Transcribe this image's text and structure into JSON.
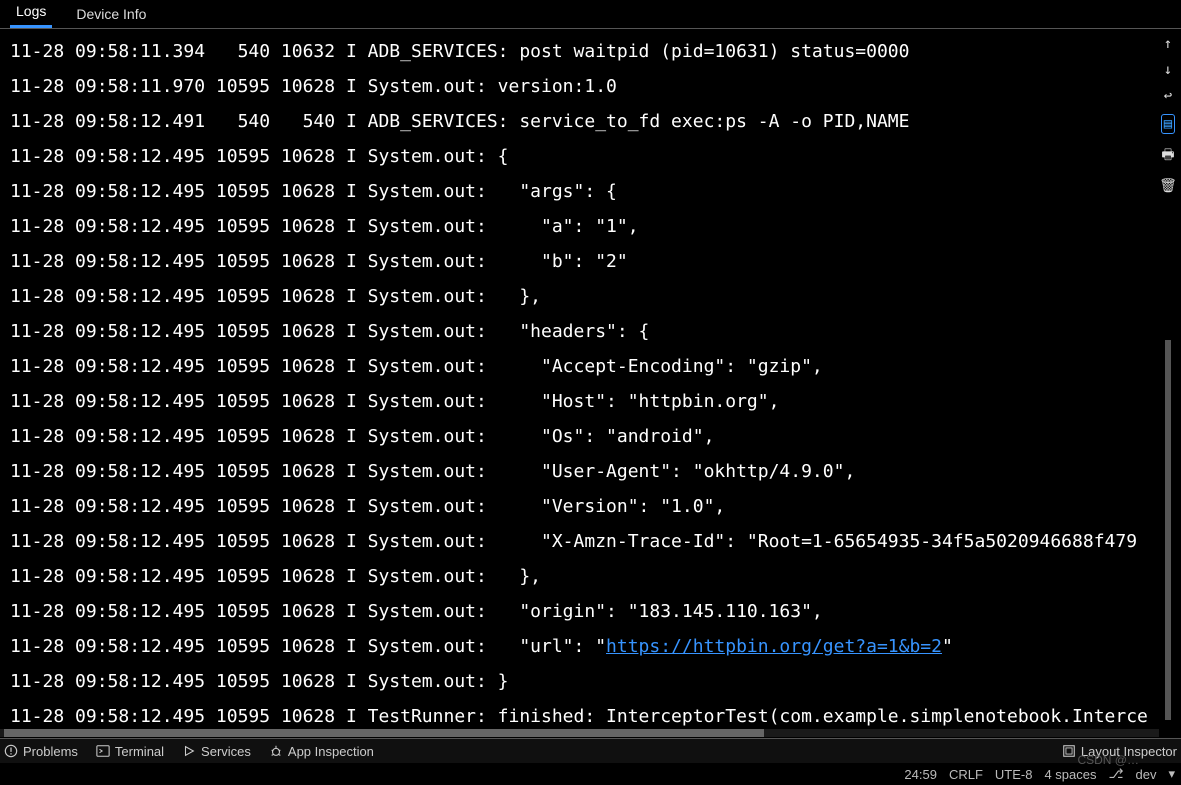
{
  "tabs": {
    "logs": "Logs",
    "device_info": "Device Info",
    "active": "logs"
  },
  "right_icons": [
    "arrow-up",
    "arrow-down",
    "wrap",
    "layout",
    "print",
    "trash"
  ],
  "right_selected_index": 3,
  "log_lines": [
    {
      "date": "11-28",
      "time": "09:58:11.394",
      "pid": "  540",
      "tid": "10632",
      "lvl": "I",
      "tag": "ADB_SERVICES",
      "msg": "post waitpid (pid=10631) status=0000"
    },
    {
      "date": "11-28",
      "time": "09:58:11.970",
      "pid": "10595",
      "tid": "10628",
      "lvl": "I",
      "tag": "System.out",
      "msg": "version:1.0"
    },
    {
      "date": "11-28",
      "time": "09:58:12.491",
      "pid": "  540",
      "tid": "  540",
      "lvl": "I",
      "tag": "ADB_SERVICES",
      "msg": "service_to_fd exec:ps -A -o PID,NAME"
    },
    {
      "date": "11-28",
      "time": "09:58:12.495",
      "pid": "10595",
      "tid": "10628",
      "lvl": "I",
      "tag": "System.out",
      "msg": "{"
    },
    {
      "date": "11-28",
      "time": "09:58:12.495",
      "pid": "10595",
      "tid": "10628",
      "lvl": "I",
      "tag": "System.out",
      "msg": "  \"args\": {"
    },
    {
      "date": "11-28",
      "time": "09:58:12.495",
      "pid": "10595",
      "tid": "10628",
      "lvl": "I",
      "tag": "System.out",
      "msg": "    \"a\": \"1\", "
    },
    {
      "date": "11-28",
      "time": "09:58:12.495",
      "pid": "10595",
      "tid": "10628",
      "lvl": "I",
      "tag": "System.out",
      "msg": "    \"b\": \"2\""
    },
    {
      "date": "11-28",
      "time": "09:58:12.495",
      "pid": "10595",
      "tid": "10628",
      "lvl": "I",
      "tag": "System.out",
      "msg": "  }, "
    },
    {
      "date": "11-28",
      "time": "09:58:12.495",
      "pid": "10595",
      "tid": "10628",
      "lvl": "I",
      "tag": "System.out",
      "msg": "  \"headers\": {"
    },
    {
      "date": "11-28",
      "time": "09:58:12.495",
      "pid": "10595",
      "tid": "10628",
      "lvl": "I",
      "tag": "System.out",
      "msg": "    \"Accept-Encoding\": \"gzip\", "
    },
    {
      "date": "11-28",
      "time": "09:58:12.495",
      "pid": "10595",
      "tid": "10628",
      "lvl": "I",
      "tag": "System.out",
      "msg": "    \"Host\": \"httpbin.org\", "
    },
    {
      "date": "11-28",
      "time": "09:58:12.495",
      "pid": "10595",
      "tid": "10628",
      "lvl": "I",
      "tag": "System.out",
      "msg": "    \"Os\": \"android\", "
    },
    {
      "date": "11-28",
      "time": "09:58:12.495",
      "pid": "10595",
      "tid": "10628",
      "lvl": "I",
      "tag": "System.out",
      "msg": "    \"User-Agent\": \"okhttp/4.9.0\", "
    },
    {
      "date": "11-28",
      "time": "09:58:12.495",
      "pid": "10595",
      "tid": "10628",
      "lvl": "I",
      "tag": "System.out",
      "msg": "    \"Version\": \"1.0\", "
    },
    {
      "date": "11-28",
      "time": "09:58:12.495",
      "pid": "10595",
      "tid": "10628",
      "lvl": "I",
      "tag": "System.out",
      "msg": "    \"X-Amzn-Trace-Id\": \"Root=1-65654935-34f5a5020946688f479"
    },
    {
      "date": "11-28",
      "time": "09:58:12.495",
      "pid": "10595",
      "tid": "10628",
      "lvl": "I",
      "tag": "System.out",
      "msg": "  }, "
    },
    {
      "date": "11-28",
      "time": "09:58:12.495",
      "pid": "10595",
      "tid": "10628",
      "lvl": "I",
      "tag": "System.out",
      "msg": "  \"origin\": \"183.145.110.163\", "
    },
    {
      "date": "11-28",
      "time": "09:58:12.495",
      "pid": "10595",
      "tid": "10628",
      "lvl": "I",
      "tag": "System.out",
      "msg": "  \"url\": \"",
      "link": "https://httpbin.org/get?a=1&b=2",
      "after": "\""
    },
    {
      "date": "11-28",
      "time": "09:58:12.495",
      "pid": "10595",
      "tid": "10628",
      "lvl": "I",
      "tag": "System.out",
      "msg": "}"
    },
    {
      "date": "11-28",
      "time": "09:58:12.495",
      "pid": "10595",
      "tid": "10628",
      "lvl": "I",
      "tag": "TestRunner",
      "msg": "finished: InterceptorTest(com.example.simplenotebook.Interce"
    }
  ],
  "bottom": {
    "problems": "Problems",
    "terminal": "Terminal",
    "services": "Services",
    "app_inspection": "App Inspection",
    "layout_inspector": "Layout Inspector"
  },
  "status": {
    "pos": "24:59",
    "line_sep": "CRLF",
    "encoding": "UTE-8",
    "indent": "4 spaces",
    "branch_icon": "⎇",
    "branch": "dev"
  },
  "watermark": "CSDN @…"
}
